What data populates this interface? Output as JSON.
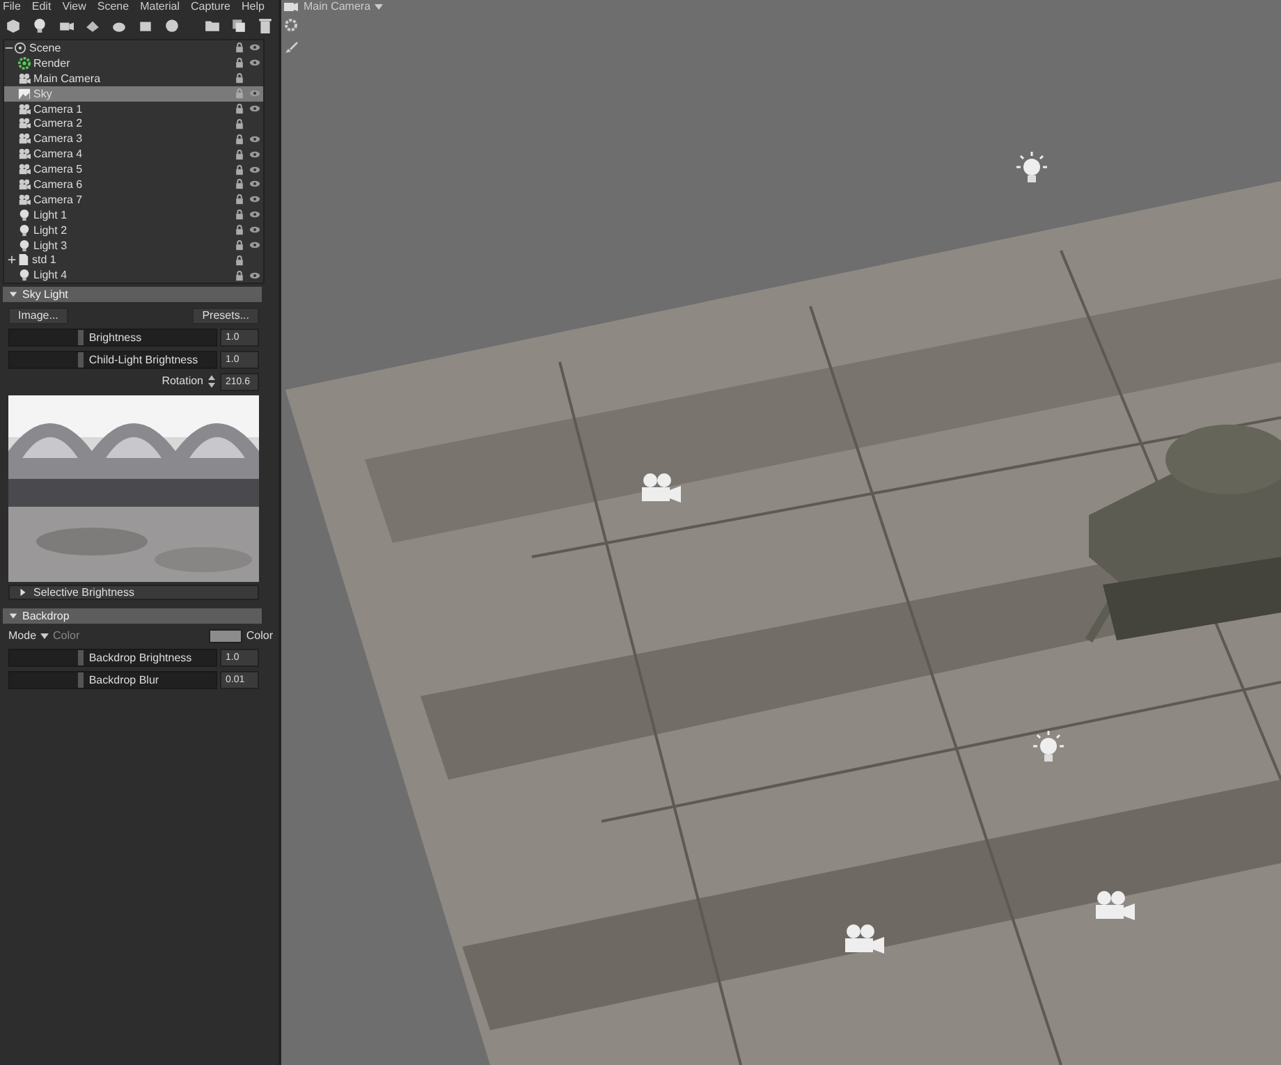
{
  "menu": [
    "File",
    "Edit",
    "View",
    "Scene",
    "Material",
    "Capture",
    "Help"
  ],
  "scene_tree": {
    "label": "Scene",
    "expanded": true,
    "lock": true,
    "eye": true,
    "children": [
      {
        "label": "Render",
        "kind": "render",
        "selected": false,
        "lock": true,
        "eye": true
      },
      {
        "label": "Main Camera",
        "kind": "camera",
        "selected": false,
        "lock": true,
        "eye": false
      },
      {
        "label": "Sky",
        "kind": "sky",
        "selected": true,
        "lock": true,
        "eye": true
      },
      {
        "label": "Camera 1",
        "kind": "camera",
        "selected": false,
        "lock": true,
        "eye": true
      },
      {
        "label": "Camera 2",
        "kind": "camera",
        "selected": false,
        "lock": true,
        "eye": false
      },
      {
        "label": "Camera 3",
        "kind": "camera",
        "selected": false,
        "lock": true,
        "eye": true
      },
      {
        "label": "Camera 4",
        "kind": "camera",
        "selected": false,
        "lock": true,
        "eye": true
      },
      {
        "label": "Camera 5",
        "kind": "camera",
        "selected": false,
        "lock": true,
        "eye": true
      },
      {
        "label": "Camera 6",
        "kind": "camera",
        "selected": false,
        "lock": true,
        "eye": true
      },
      {
        "label": "Camera 7",
        "kind": "camera",
        "selected": false,
        "lock": true,
        "eye": true
      },
      {
        "label": "Light 1",
        "kind": "light",
        "selected": false,
        "lock": true,
        "eye": true
      },
      {
        "label": "Light 2",
        "kind": "light",
        "selected": false,
        "lock": true,
        "eye": true
      },
      {
        "label": "Light 3",
        "kind": "light",
        "selected": false,
        "lock": true,
        "eye": true
      },
      {
        "label": "std 1",
        "kind": "model",
        "selected": false,
        "lock": true,
        "eye": false,
        "expanded": false
      },
      {
        "label": "Light 4",
        "kind": "light",
        "selected": false,
        "lock": true,
        "eye": true
      }
    ]
  },
  "sky_light": {
    "title": "Sky Light",
    "expanded": true,
    "image_button": "Image...",
    "presets_button": "Presets...",
    "sliders": [
      {
        "label": "Brightness",
        "value": "1.0",
        "level": 0.33
      },
      {
        "label": "Child-Light Brightness",
        "value": "1.0",
        "level": 0.33
      }
    ],
    "rotation": {
      "label": "Rotation",
      "value": "210.6"
    },
    "selective_brightness": {
      "title": "Selective Brightness",
      "expanded": false
    }
  },
  "backdrop": {
    "title": "Backdrop",
    "expanded": true,
    "mode_label": "Mode",
    "mode_value": "Color",
    "color_label": "Color",
    "sliders": [
      {
        "label": "Backdrop Brightness",
        "value": "1.0",
        "level": 0.33
      },
      {
        "label": "Backdrop Blur",
        "value": "0.01",
        "level": 0.33
      }
    ]
  },
  "viewport": {
    "camera_menu": "Main Camera",
    "gizmos": [
      {
        "kind": "light"
      },
      {
        "kind": "camera"
      },
      {
        "kind": "light"
      },
      {
        "kind": "camera"
      },
      {
        "kind": "camera"
      }
    ]
  }
}
